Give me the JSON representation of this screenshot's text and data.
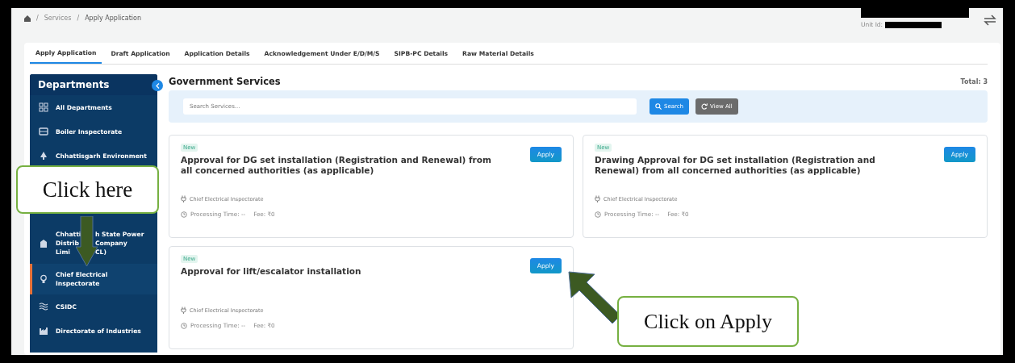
{
  "breadcrumb": {
    "separator": "/",
    "items": [
      "Services",
      "Apply Application"
    ]
  },
  "account": {
    "unit_label": "Unit Id:"
  },
  "tabs": [
    {
      "label": "Apply Application",
      "selected": true
    },
    {
      "label": "Draft Application",
      "selected": false
    },
    {
      "label": "Application Details",
      "selected": false
    },
    {
      "label": "Acknowledgement Under E/D/M/S",
      "selected": false
    },
    {
      "label": "SIPB-PC Details",
      "selected": false
    },
    {
      "label": "Raw Material Details",
      "selected": false
    }
  ],
  "sidebar": {
    "title": "Departments",
    "items": [
      {
        "kind": "text",
        "label": "All Departments",
        "selected": false
      },
      {
        "kind": "text",
        "label": "Boiler Inspectorate",
        "selected": false
      },
      {
        "kind": "covered",
        "label": "Chhattisgarh Environment",
        "selected": false
      },
      {
        "kind": "split",
        "label_lines": [
          [
            "Chhatti",
            "h State Power"
          ],
          [
            "Distrib",
            "Company"
          ],
          [
            "Limi",
            "CL)"
          ]
        ],
        "selected": false
      },
      {
        "kind": "text",
        "label": "Chief Electrical Inspectorate",
        "selected": true
      },
      {
        "kind": "text",
        "label": "CSIDC",
        "selected": false
      },
      {
        "kind": "text",
        "label": "Directorate of Industries",
        "selected": false
      }
    ]
  },
  "main": {
    "title": "Government Services",
    "total": "Total: 3",
    "search": {
      "placeholder": "Search Services...",
      "button": "Search",
      "view_all": "View All"
    },
    "cards": [
      {
        "badge": "New",
        "title": "Approval for DG set installation (Registration and Renewal) from all concerned authorities (as applicable)",
        "department": "Chief Electrical Inspectorate",
        "processing": "Processing Time: --",
        "fee": "Fee: ₹0",
        "button": "Apply"
      },
      {
        "badge": "New",
        "title": "Drawing Approval for DG set installation (Registration and Renewal) from all concerned authorities (as applicable)",
        "department": "Chief Electrical Inspectorate",
        "processing": "Processing Time: --",
        "fee": "Fee: ₹0",
        "button": "Apply"
      },
      {
        "badge": "New",
        "title": "Approval for lift/escalator installation",
        "department": "Chief Electrical Inspectorate",
        "processing": "Processing Time: --",
        "fee": "Fee: ₹0",
        "button": "Apply"
      }
    ]
  },
  "annotations": [
    {
      "kind": "down",
      "text": "Click here"
    },
    {
      "kind": "diagonal",
      "text": "Click on Apply"
    }
  ]
}
